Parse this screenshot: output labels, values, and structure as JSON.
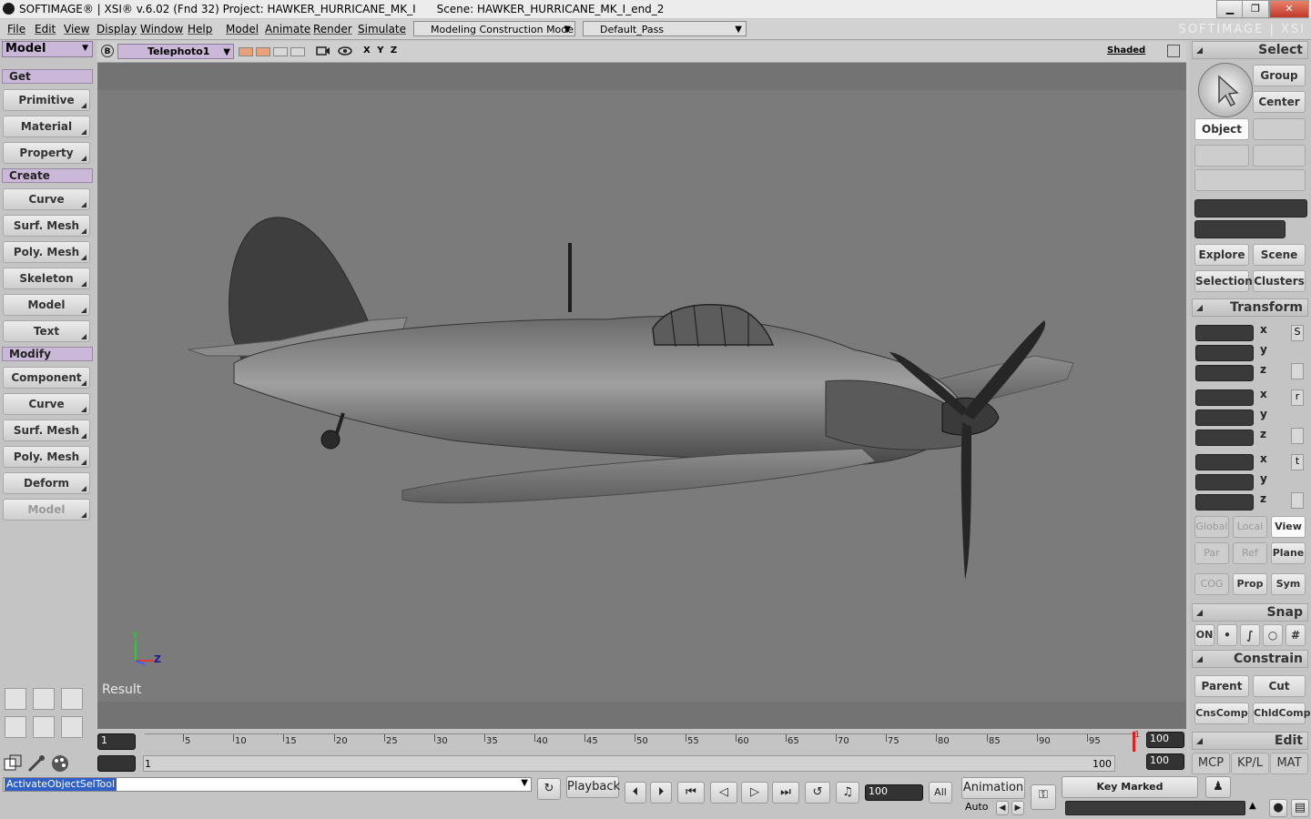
{
  "titlebar": {
    "title": "SOFTIMAGE® | XSI® v.6.02 (Fnd 32) Project: HAWKER_HURRICANE_MK_I      Scene: HAWKER_HURRICANE_MK_I_end_2",
    "min": "▁",
    "max": "❐",
    "close": "✕"
  },
  "menubar": {
    "menus": [
      "File",
      "Edit",
      "View",
      "Display",
      "Window",
      "Help",
      "Model",
      "Animate",
      "Render",
      "Simulate"
    ],
    "construction_mode": "Modeling Construction Mode",
    "pass": "Default_Pass",
    "brand": "SOFTIMAGE | XSI"
  },
  "left_panel": {
    "module": "Model",
    "get_label": "Get",
    "get_items": [
      "Primitive",
      "Material",
      "Property"
    ],
    "create_label": "Create",
    "create_items": [
      "Curve",
      "Surf. Mesh",
      "Poly. Mesh",
      "Skeleton",
      "Model",
      "Text"
    ],
    "modify_label": "Modify",
    "modify_items": [
      "Component",
      "Curve",
      "Surf. Mesh",
      "Poly. Mesh",
      "Deform",
      "Model"
    ]
  },
  "viewport": {
    "mode_letter": "B",
    "camera": "Telephoto1",
    "axes": "X Y Z",
    "display_mode": "Shaded",
    "result_label": "Result",
    "axis_y": "Y",
    "axis_z": "Z"
  },
  "right_panel": {
    "select_title": "Select",
    "group": "Group",
    "center": "Center",
    "object": "Object",
    "explore": "Explore",
    "scene": "Scene",
    "selection": "Selection",
    "clusters": "Clusters",
    "transform_title": "Transform",
    "axes": [
      "x",
      "y",
      "z"
    ],
    "scale": "S",
    "rotate": "r",
    "translate": "t",
    "global": "Global",
    "local": "Local",
    "view": "View",
    "par": "Par",
    "ref": "Ref",
    "plane": "Plane",
    "cog": "COG",
    "prop": "Prop",
    "sym": "Sym",
    "snap_title": "Snap",
    "snap_on": "ON",
    "constrain_title": "Constrain",
    "parent": "Parent",
    "cut": "Cut",
    "cnscomp": "CnsComp",
    "chldcomp": "ChldComp",
    "edit_title": "Edit",
    "tabs": [
      "MCP",
      "KP/L",
      "MAT"
    ]
  },
  "timeline": {
    "start_frame": "1",
    "end_frame": "100",
    "current_frame": "1",
    "range_start": "1",
    "range_end": "100",
    "range_end_field": "100",
    "ticks": [
      "5",
      "10",
      "15",
      "20",
      "25",
      "30",
      "35",
      "40",
      "45",
      "50",
      "55",
      "60",
      "65",
      "70",
      "75",
      "80",
      "85",
      "90",
      "95"
    ]
  },
  "bottombar": {
    "command": "ActivateObjectSelTool",
    "playback": "Playback",
    "frame_field": "100",
    "all": "All",
    "animation": "Animation",
    "auto": "Auto",
    "key_marked": "Key Marked Parameters"
  }
}
